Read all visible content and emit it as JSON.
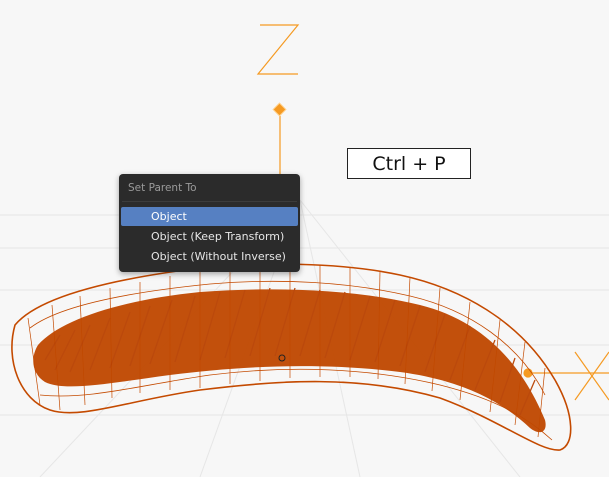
{
  "viewport": {
    "axis_label": "Z",
    "accent_color": "#f59a22",
    "mesh_color": "#c44a00"
  },
  "shortcut": {
    "text": "Ctrl + P"
  },
  "menu": {
    "title": "Set Parent To",
    "items": [
      {
        "label": "Object",
        "active": true
      },
      {
        "label": "Object (Keep Transform)",
        "active": false
      },
      {
        "label": "Object (Without Inverse)",
        "active": false
      }
    ]
  }
}
